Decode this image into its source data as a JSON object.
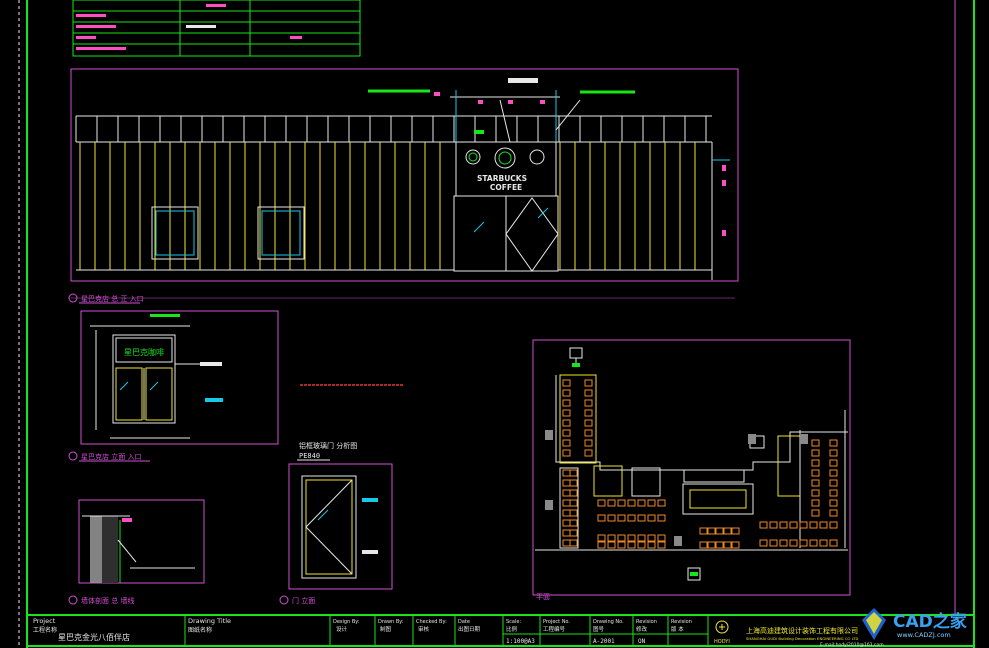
{
  "logo": {
    "text": "STARBUCKS",
    "text2": "COFFEE"
  },
  "labels": {
    "elev_main": "星巴克店 总 正 入口",
    "elev_side": "星巴克店 立面 入口",
    "section": "墙体剖面 总 墙线",
    "door": "门 立面",
    "door_title": "铝框玻璃门 分析图",
    "door_code": "PE840",
    "sign": "星巴克咖啡",
    "plan": "平面"
  },
  "title_block": {
    "project_label": "Project",
    "project_label_cn": "工程名称",
    "project_name": "星巴克金光八佰伴店",
    "drawing_title_label": "Drawing Title",
    "drawing_title_cn": "图纸名称",
    "design_by_label": "Design By:",
    "design_by": "设计",
    "drawn_by_label": "Drawn By:",
    "drawn_by": "制图",
    "checked_by_label": "Checked By:",
    "checked_by": "审核",
    "date_label": "Date",
    "date": "出图日期",
    "scale_label": "Scale:",
    "scale": "比例",
    "scale_value": "1:100@A3",
    "project_no_label": "Project No.",
    "project_no": "工程编号",
    "drawing_no_label": "Drawing No.",
    "drawing_no": "图号",
    "drawing_no_value": "A-2001",
    "revision_label": "Revision",
    "revision": "修改",
    "revision_value": "ON",
    "revision2_label": "Revision",
    "revision2": "版 本",
    "company_cn": "上海高迪建筑设计装饰工程有限公司",
    "company_en": "SHANGHAI GUDI Building Decoration ENGINEERING CO LTD",
    "email": "E-mail:hodyi2010@163.com",
    "logo_text": "HODYI"
  },
  "watermark": {
    "text": "CAD之家",
    "url": "www.CADZJ.com"
  },
  "colors": {
    "green": "#19e619",
    "magenta": "#d24fd2",
    "white": "#e8e8e8",
    "cyan": "#18c8e8",
    "orange": "#f08a24",
    "yellow": "#f0e62a",
    "pink": "#ff4dc4",
    "red": "#e23a2a"
  }
}
